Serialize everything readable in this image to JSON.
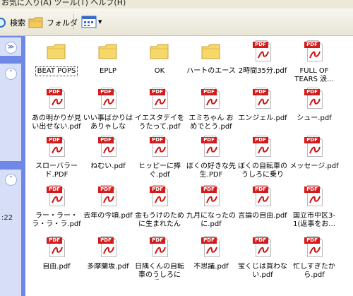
{
  "menubar": {
    "text": "お気に入り(A)   ツール(T)   ヘルプ(H)"
  },
  "toolbar": {
    "search_label": "検索",
    "folder_label": "フォルダ"
  },
  "left": {
    "time_text": ":22"
  },
  "icons": {
    "folder": "folder-icon",
    "pdf": "pdf-file-icon",
    "search": "search-icon",
    "views": "views-icon"
  },
  "colors": {
    "pdf_red": "#d41a1a",
    "folder_yellow": "#f6d86a",
    "sidebar_blue": "#6f88e5"
  },
  "items": [
    {
      "label": "BEAT POPS",
      "type": "folder",
      "selected": true
    },
    {
      "label": "EPLP",
      "type": "folder"
    },
    {
      "label": "OK",
      "type": "folder"
    },
    {
      "label": "ハートのエース",
      "type": "folder"
    },
    {
      "label": "2時間35分.pdf",
      "type": "pdf"
    },
    {
      "label": "FULL OF TEARS 涙...",
      "type": "pdf"
    },
    {
      "label": "あの明かりが見い出せない.pdf",
      "type": "pdf"
    },
    {
      "label": "いい事ばかりはありゃしない.pdf",
      "type": "pdf"
    },
    {
      "label": "イエスタデイをうたって.pdf",
      "type": "pdf"
    },
    {
      "label": "エミちゃん おめでとう.pdf",
      "type": "pdf"
    },
    {
      "label": "エンジェル.pdf",
      "type": "pdf"
    },
    {
      "label": "シュー.pdf",
      "type": "pdf"
    },
    {
      "label": "スローバラード.PDF",
      "type": "pdf"
    },
    {
      "label": "ねむい.pdf",
      "type": "pdf"
    },
    {
      "label": "ヒッピーに捧ぐ.pdf",
      "type": "pdf"
    },
    {
      "label": "ぼくの好きな先生.PDF",
      "type": "pdf"
    },
    {
      "label": "ぼくの自転車のうしろに乗りな...",
      "type": "pdf"
    },
    {
      "label": "メッセージ.pdf",
      "type": "pdf"
    },
    {
      "label": "ラー・ラー・ラ・ラ・ラ.pdf",
      "type": "pdf"
    },
    {
      "label": "去年の今頃.pdf",
      "type": "pdf"
    },
    {
      "label": "金もうけのために生まれたんじ...",
      "type": "pdf"
    },
    {
      "label": "九月になったのに.pdf",
      "type": "pdf"
    },
    {
      "label": "言論の自由.pdf",
      "type": "pdf"
    },
    {
      "label": "国立市中区3-1(返事をお...",
      "type": "pdf"
    },
    {
      "label": "自由.pdf",
      "type": "pdf"
    },
    {
      "label": "多摩蘭坂.pdf",
      "type": "pdf"
    },
    {
      "label": "日隅くんの自転車のうしろに乗...",
      "type": "pdf"
    },
    {
      "label": "不思議.pdf",
      "type": "pdf"
    },
    {
      "label": "宝くじは買わない.pdf",
      "type": "pdf"
    },
    {
      "label": "忙しすぎたから.pdf",
      "type": "pdf"
    }
  ]
}
